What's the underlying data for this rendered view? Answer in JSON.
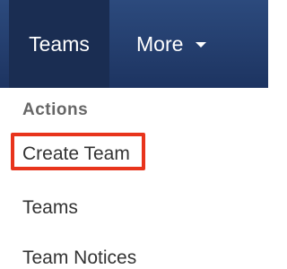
{
  "navbar": {
    "teams_label": "Teams",
    "more_label": "More"
  },
  "menu": {
    "header": "Actions",
    "items": [
      {
        "label": "Create Team"
      },
      {
        "label": "Teams"
      },
      {
        "label": "Team Notices"
      }
    ]
  },
  "colors": {
    "navbar_bg": "#24406f",
    "active_tab_bg": "#1a2d52",
    "highlight": "#e8341c"
  }
}
